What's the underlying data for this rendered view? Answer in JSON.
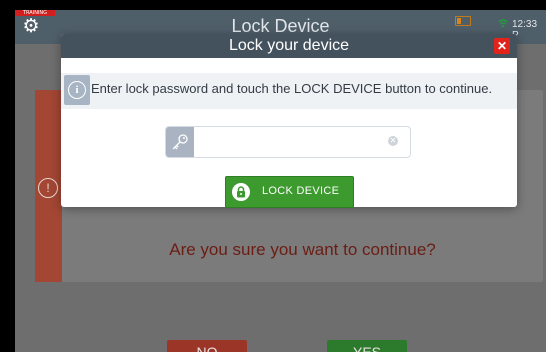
{
  "topbar": {
    "training_tag": "TRAINING",
    "title": "Lock Device",
    "time": "12:33 P"
  },
  "background_dialog": {
    "question": "Are you sure you want to continue?",
    "no_label": "NO",
    "yes_label": "YES"
  },
  "modal": {
    "title": "Lock your device",
    "close_icon": "close-icon",
    "info_text": "Enter lock password and touch the LOCK DEVICE button to continue.",
    "password": {
      "value": "",
      "placeholder": ""
    },
    "lock_button_label": "LOCK DEVICE"
  },
  "colors": {
    "header": "#44525d",
    "accent_green": "#3d9a2f",
    "close_red": "#e2231a",
    "danger": "#a34634"
  }
}
